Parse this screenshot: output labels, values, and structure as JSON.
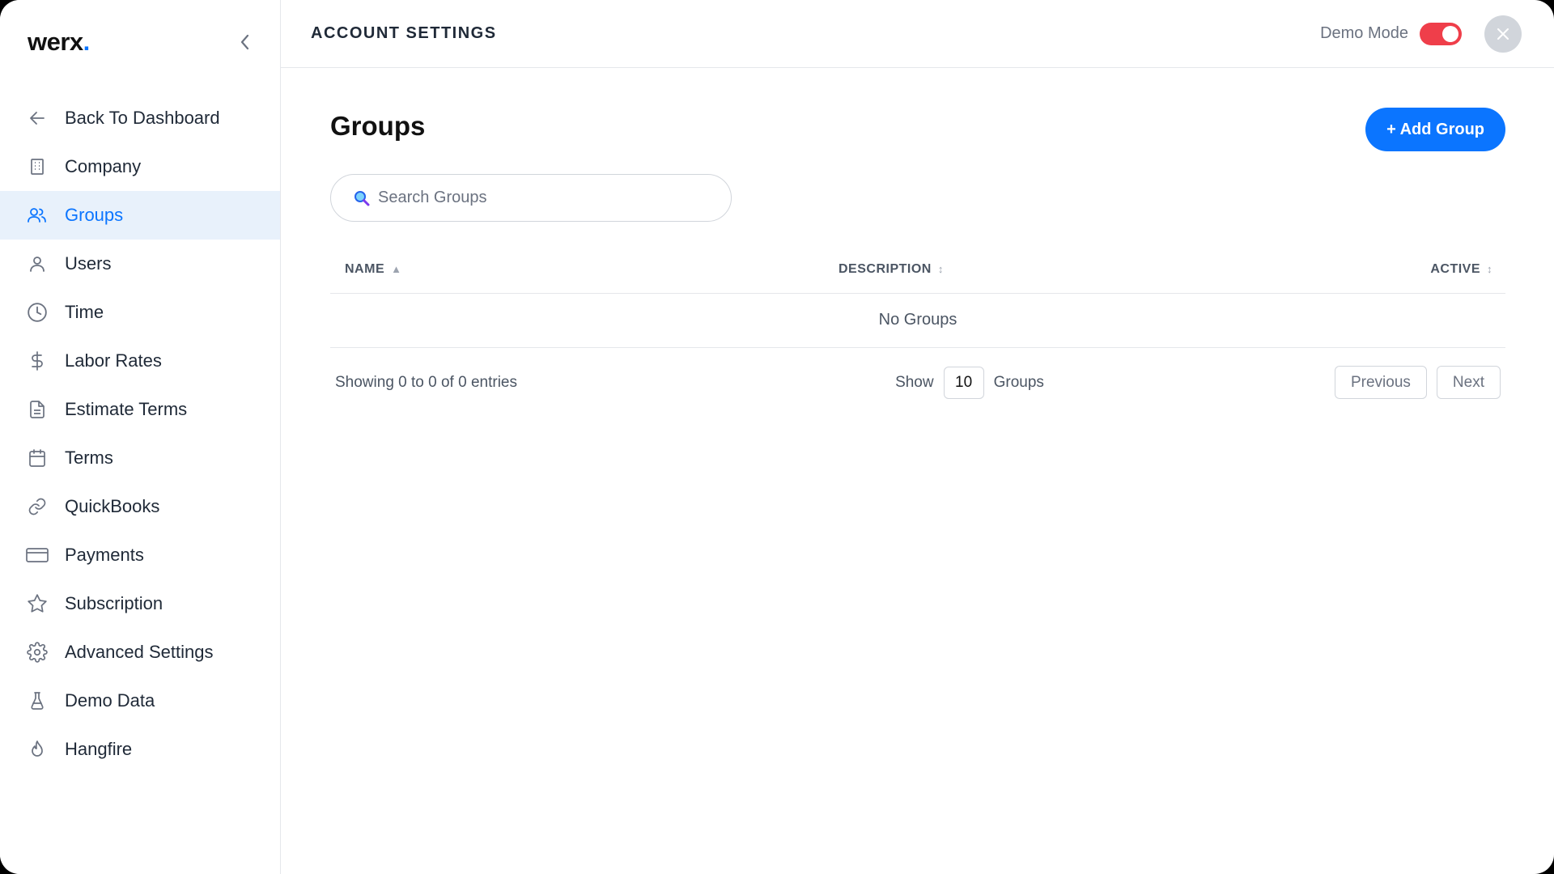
{
  "app": {
    "logo_text": "werx",
    "logo_dot": ".",
    "brand_color": "#0b75ff",
    "accent_toggle_color": "#ef3e4a"
  },
  "sidebar": {
    "items": [
      {
        "label": "Back To Dashboard",
        "icon": "arrow-left-icon",
        "active": false
      },
      {
        "label": "Company",
        "icon": "building-icon",
        "active": false
      },
      {
        "label": "Groups",
        "icon": "users-icon",
        "active": true
      },
      {
        "label": "Users",
        "icon": "user-icon",
        "active": false
      },
      {
        "label": "Time",
        "icon": "clock-icon",
        "active": false
      },
      {
        "label": "Labor Rates",
        "icon": "dollar-icon",
        "active": false
      },
      {
        "label": "Estimate Terms",
        "icon": "document-icon",
        "active": false
      },
      {
        "label": "Terms",
        "icon": "calendar-icon",
        "active": false
      },
      {
        "label": "QuickBooks",
        "icon": "link-icon",
        "active": false
      },
      {
        "label": "Payments",
        "icon": "credit-card-icon",
        "active": false
      },
      {
        "label": "Subscription",
        "icon": "star-icon",
        "active": false
      },
      {
        "label": "Advanced Settings",
        "icon": "gear-icon",
        "active": false
      },
      {
        "label": "Demo Data",
        "icon": "flask-icon",
        "active": false
      },
      {
        "label": "Hangfire",
        "icon": "flame-icon",
        "active": false
      }
    ]
  },
  "header": {
    "title": "ACCOUNT SETTINGS",
    "demo_mode_label": "Demo Mode",
    "demo_mode_on": true
  },
  "main": {
    "page_title": "Groups",
    "add_button_label": "+ Add Group",
    "search_placeholder": "Search Groups",
    "table": {
      "columns": [
        {
          "label": "NAME",
          "sort": "▲"
        },
        {
          "label": "DESCRIPTION",
          "sort": "↕"
        },
        {
          "label": "ACTIVE",
          "sort": "↕"
        }
      ],
      "empty_text": "No Groups"
    },
    "footer": {
      "entries_text": "Showing 0 to 0 of 0 entries",
      "show_label": "Show",
      "page_size": "10",
      "page_size_suffix": "Groups",
      "previous_label": "Previous",
      "next_label": "Next"
    }
  }
}
